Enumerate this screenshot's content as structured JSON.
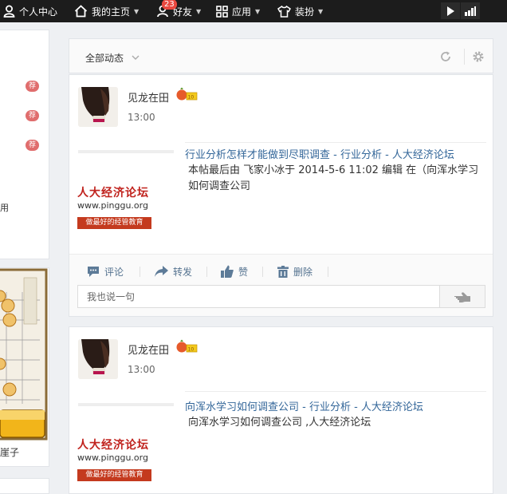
{
  "topbar": {
    "items": [
      {
        "label": "个人中心"
      },
      {
        "label": "我的主页"
      },
      {
        "label": "好友",
        "badge": "23"
      },
      {
        "label": "应用"
      },
      {
        "label": "装扮"
      }
    ]
  },
  "sidebar": {
    "rec_label": "荐",
    "partial_text": "用",
    "game_partial_label": "崖子"
  },
  "feed": {
    "filter_label": "全部动态",
    "posts": [
      {
        "user": "见龙在田",
        "time": "13:00",
        "title": "行业分析怎样才能做到尽职调查 - 行业分析 - 人大经济论坛",
        "body": "本帖最后由 飞家小冰于 2014-5-6 11:02 编辑 在（向浑水学习如何调查公司",
        "thumb": {
          "line1": "人大经济论坛",
          "line2": "www.pinggu.org",
          "line3": "做最好的经管教育"
        },
        "actions": {
          "comment": "评论",
          "forward": "转发",
          "like": "赞",
          "delete": "删除"
        },
        "comment_placeholder": "我也说一句"
      },
      {
        "user": "见龙在田",
        "time": "13:00",
        "title": "向浑水学习如何调查公司 - 行业分析 - 人大经济论坛",
        "body": "向浑水学习如何调查公司 ,人大经济论坛",
        "thumb": {
          "line1": "人大经济论坛",
          "line2": "www.pinggu.org",
          "line3": "做最好的经管教育"
        }
      }
    ]
  },
  "colors": {
    "topbar": "#1c1c1c",
    "badge": "#e9483f",
    "link": "#336699",
    "action": "#557390",
    "rec": "#e06d6d"
  }
}
